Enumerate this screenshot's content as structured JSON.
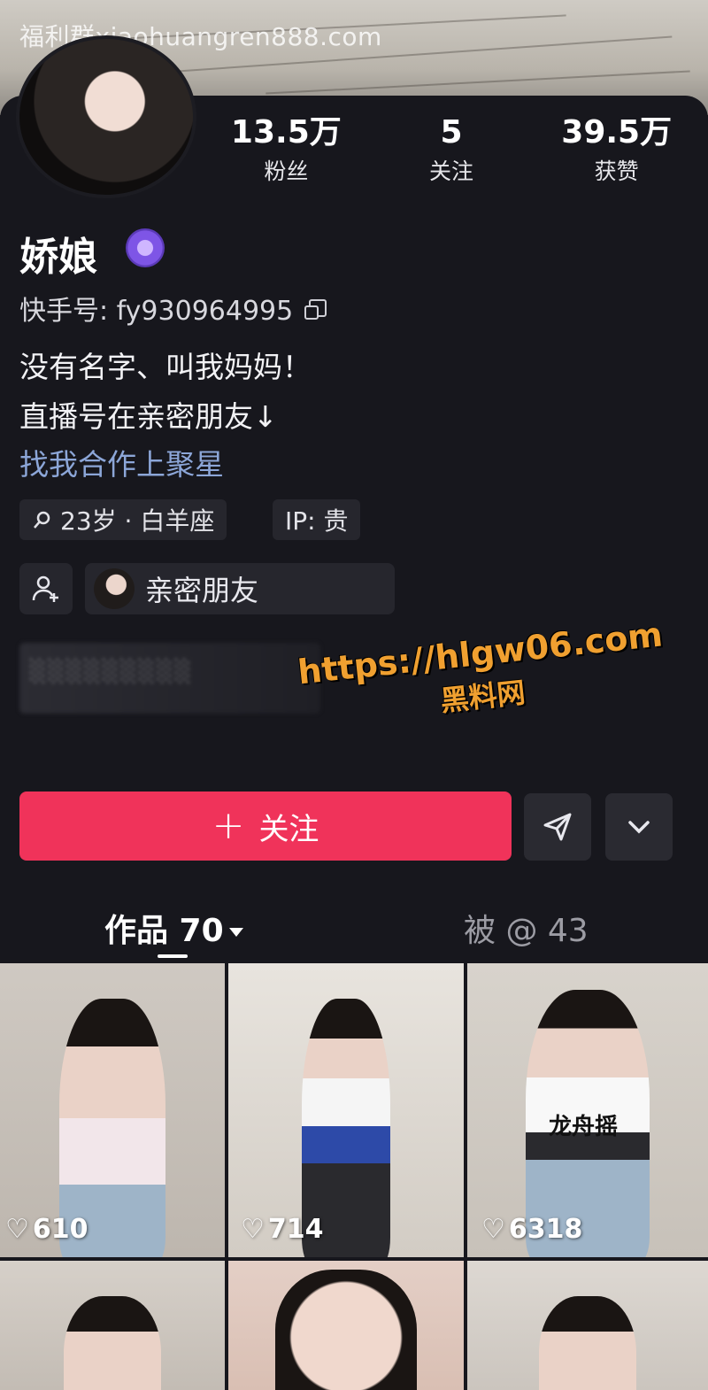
{
  "watermark": "福利群xiaohuangren888.com",
  "profile": {
    "name": "娇娘",
    "kuaishou_id": "快手号: fy930964995",
    "stats": [
      {
        "value": "13.5万",
        "label": "粉丝"
      },
      {
        "value": "5",
        "label": "关注"
      },
      {
        "value": "39.5万",
        "label": "获赞"
      }
    ],
    "bio": [
      "没有名字、叫我妈妈！",
      "直播号在亲密朋友↓",
      "找我合作上聚星"
    ],
    "tags": [
      "23岁 · 白羊座",
      "IP: 贵"
    ],
    "friend_label": "亲密朋友",
    "blurred_text": "░░░░░░░░░"
  },
  "promo": {
    "url": "https://hlgw06.com",
    "name": "黑料网"
  },
  "actions": {
    "follow_label": "关注",
    "follow_plus": "+"
  },
  "tabs": [
    {
      "label": "作品 70"
    },
    {
      "label": "被 @ 43"
    }
  ],
  "videos": [
    {
      "likes": "610"
    },
    {
      "likes": "714"
    },
    {
      "likes": "6318",
      "overlay": "龙舟摇"
    },
    {
      "likes": ""
    },
    {
      "likes": ""
    },
    {
      "likes": ""
    }
  ],
  "colors": {
    "accent": "#f0335a",
    "link": "#8ca6d8",
    "bg": "#17171d",
    "promo": "#f0a030"
  },
  "icons": [
    "copy-icon",
    "verified-badge-icon",
    "search-icon",
    "add-friend-icon",
    "share-icon",
    "chevron-down-icon",
    "heart-icon"
  ]
}
